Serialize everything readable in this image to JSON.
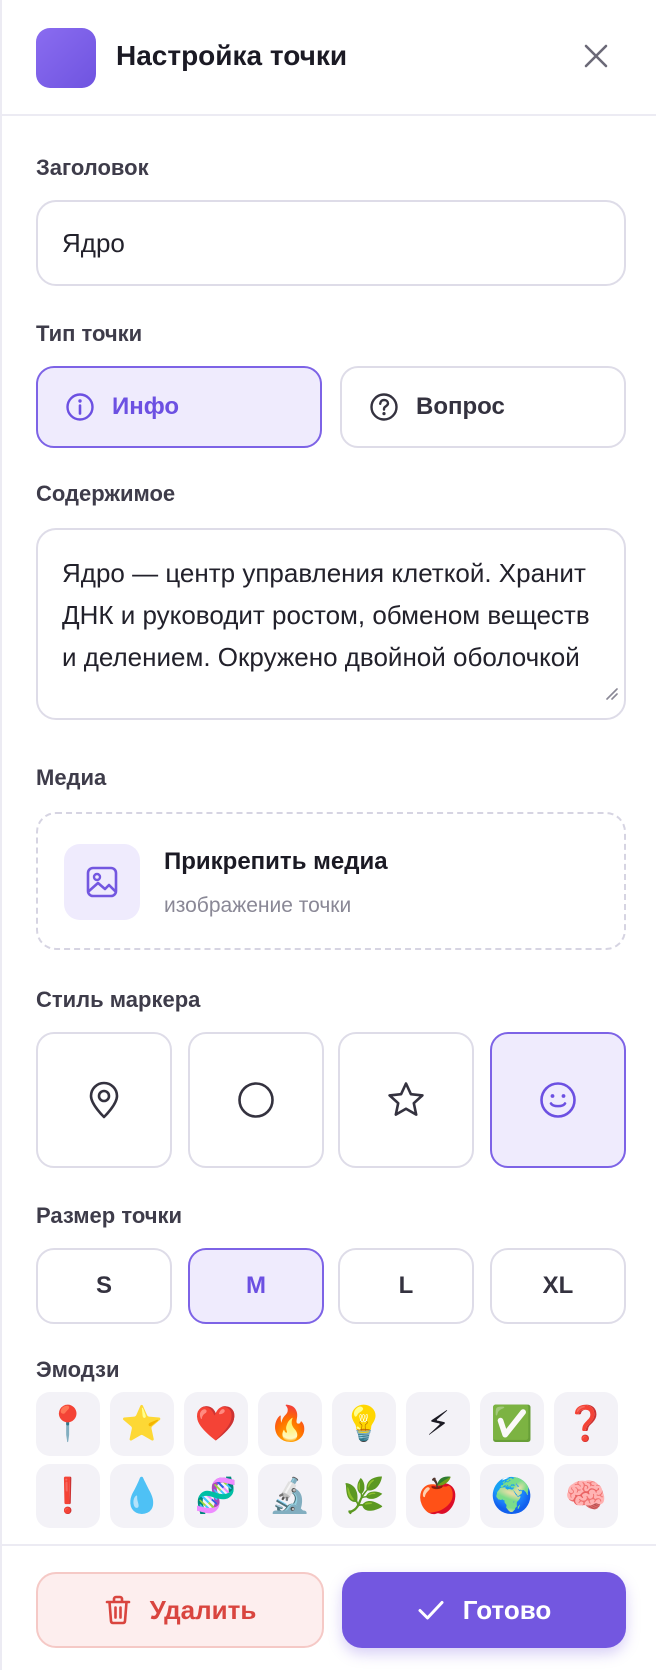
{
  "header": {
    "title": "Настройка точки",
    "logo_color": "#7b5ee8",
    "close_icon": "close-icon"
  },
  "title_field": {
    "label": "Заголовок",
    "value": "Ядро"
  },
  "point_type": {
    "label": "Тип точки",
    "options": [
      {
        "label": "Инфо",
        "icon": "info-icon",
        "selected": true
      },
      {
        "label": "Вопрос",
        "icon": "question-icon",
        "selected": false
      }
    ]
  },
  "content": {
    "label": "Содержимое",
    "value": "Ядро — центр управления клеткой. Хранит ДНК и руководит ростом, обменом веществ и делением. Окружено двойной оболочкой"
  },
  "media": {
    "label": "Медиа",
    "title": "Прикрепить медиа",
    "subtitle": "изображение точки",
    "icon": "image-icon"
  },
  "marker_style": {
    "label": "Стиль маркера",
    "options": [
      {
        "icon": "map-pin-icon",
        "selected": false
      },
      {
        "icon": "circle-icon",
        "selected": false
      },
      {
        "icon": "star-icon",
        "selected": false
      },
      {
        "icon": "smiley-icon",
        "selected": true
      }
    ]
  },
  "point_size": {
    "label": "Размер точки",
    "options": [
      {
        "label": "S",
        "selected": false
      },
      {
        "label": "M",
        "selected": true
      },
      {
        "label": "L",
        "selected": false
      },
      {
        "label": "XL",
        "selected": false
      }
    ]
  },
  "emoji": {
    "label": "Эмодзи",
    "items": [
      "📍",
      "⭐",
      "❤️",
      "🔥",
      "💡",
      "⚡",
      "✅",
      "❓",
      "❗",
      "💧",
      "🧬",
      "🔬",
      "🌿",
      "🍎",
      "🌍",
      "🧠"
    ]
  },
  "footer": {
    "delete_label": "Удалить",
    "done_label": "Готово"
  },
  "colors": {
    "accent": "#7357e0",
    "accent_light": "#efebfd",
    "danger": "#d9453f",
    "danger_light": "#fdeeee",
    "border": "#dedce8"
  }
}
